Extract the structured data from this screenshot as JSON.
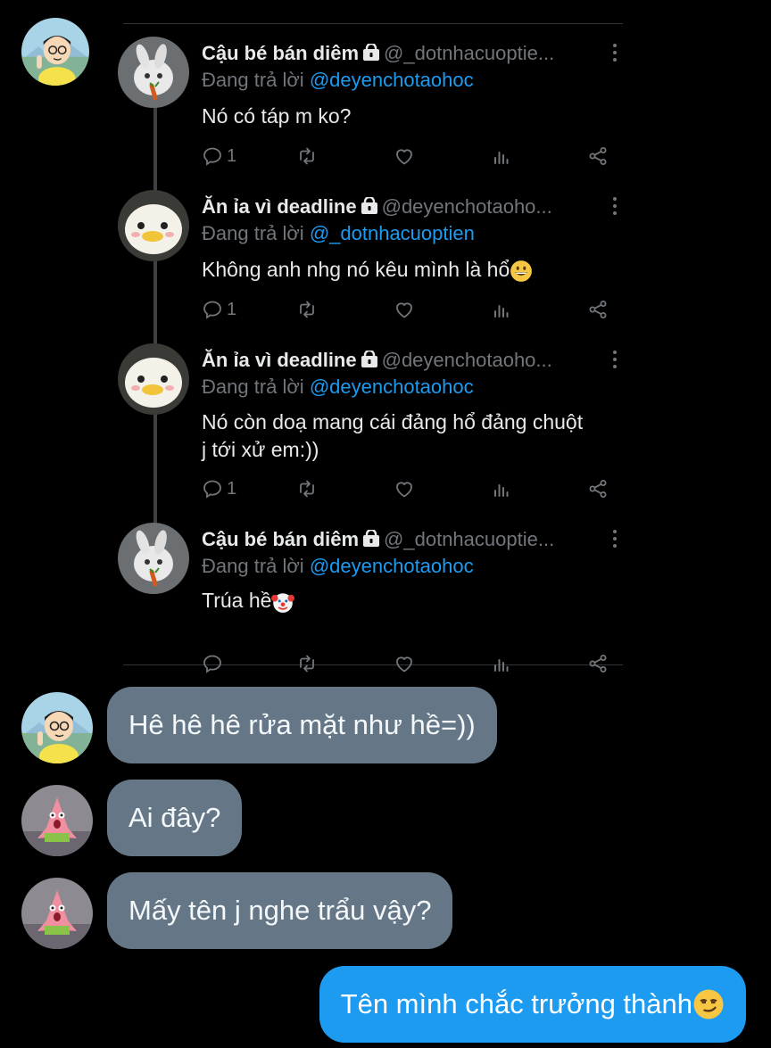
{
  "thread": {
    "tweets": [
      {
        "name": "Cậu bé bán diêm",
        "handle": "@_dotnhacuoptie...",
        "replying_prefix": "Đang trả lời",
        "replying_to": "@deyenchotaohoc",
        "text": "Nó có táp m ko?",
        "reply_count": "1",
        "avatar": "rabbit-avatar"
      },
      {
        "name": "Ăn ỉa vì deadline",
        "handle": "@deyenchotaoho...",
        "replying_prefix": "Đang trả lời",
        "replying_to": "@_dotnhacuoptien",
        "text": "Không anh nhg nó kêu mình là hổ",
        "text_emoji": "grinning-face-emoji",
        "reply_count": "1",
        "avatar": "duck-avatar"
      },
      {
        "name": "Ăn ỉa vì deadline",
        "handle": "@deyenchotaoho...",
        "replying_prefix": "Đang trả lời",
        "replying_to": "@deyenchotaohoc",
        "text_line1": "Nó còn doạ mang cái đảng hổ đảng chuột",
        "text_line2": "j tới xử em:))",
        "reply_count": "1",
        "avatar": "duck-avatar"
      },
      {
        "name": "Cậu bé bán diêm",
        "handle": "@_dotnhacuoptie...",
        "replying_prefix": "Đang trả lời",
        "replying_to": "@deyenchotaohoc",
        "text": "Trúa hề",
        "text_emoji": "clown-face-emoji",
        "reply_count": "",
        "avatar": "rabbit-avatar"
      }
    ]
  },
  "messages": [
    {
      "text": "Hê hê hê rửa mặt như hề=))",
      "sender": "nobita-avatar"
    },
    {
      "text": "Ai đây?",
      "sender": "patrick-avatar"
    },
    {
      "text": "Mấy tên j nghe trẩu vậy?",
      "sender": "patrick-avatar"
    },
    {
      "text": "Tên mình chắc trưởng thành",
      "emoji": "smirking-face-emoji",
      "sender": "me"
    }
  ],
  "colors": {
    "background": "#000000",
    "received_bubble": "#657786",
    "sent_bubble": "#1d9bf0",
    "mention": "#1d9bf0",
    "muted": "#71767b"
  }
}
